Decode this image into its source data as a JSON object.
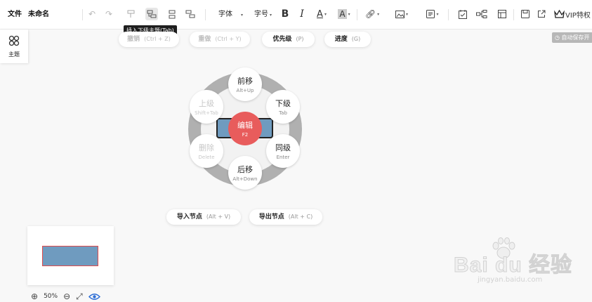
{
  "header": {
    "file_menu": "文件",
    "doc_title": "未命名"
  },
  "toolbar": {
    "font_label": "字体",
    "size_label": "字号",
    "bold_label": "B",
    "italic_label": "I",
    "font_color_label": "A",
    "highlight_label": "A",
    "vip_label": "VIP特权",
    "tooltip": "插入下级主题(Tab)"
  },
  "actions": [
    {
      "label": "撤销",
      "shortcut": "(Ctrl + Z)"
    },
    {
      "label": "重做",
      "shortcut": "(Ctrl + Y)"
    },
    {
      "label": "优先级",
      "shortcut": "(P)"
    },
    {
      "label": "进度",
      "shortcut": "(G)"
    }
  ],
  "sidebar": {
    "theme_label": "主题"
  },
  "autosave": "自动保存开",
  "radial": {
    "center": {
      "label": "编辑",
      "shortcut": "F2"
    },
    "nodes": [
      {
        "label": "前移",
        "shortcut": "Alt+Up"
      },
      {
        "label": "下级",
        "shortcut": "Tab"
      },
      {
        "label": "同级",
        "shortcut": "Enter"
      },
      {
        "label": "后移",
        "shortcut": "Alt+Down"
      },
      {
        "label": "删除",
        "shortcut": "Delete"
      },
      {
        "label": "上级",
        "shortcut": "Shift+Tab"
      }
    ]
  },
  "bottom_actions": [
    {
      "label": "导入节点",
      "shortcut": "(Alt + V)"
    },
    {
      "label": "导出节点",
      "shortcut": "(Alt + C)"
    }
  ],
  "zoom": {
    "level": "50%"
  },
  "watermark": {
    "brand": "Bai du 经验",
    "url": "jingyan.baidu.com"
  },
  "colors": {
    "accent": "#e85c5c",
    "topic": "#6f9bbf",
    "ring": "#b0b0b0"
  }
}
